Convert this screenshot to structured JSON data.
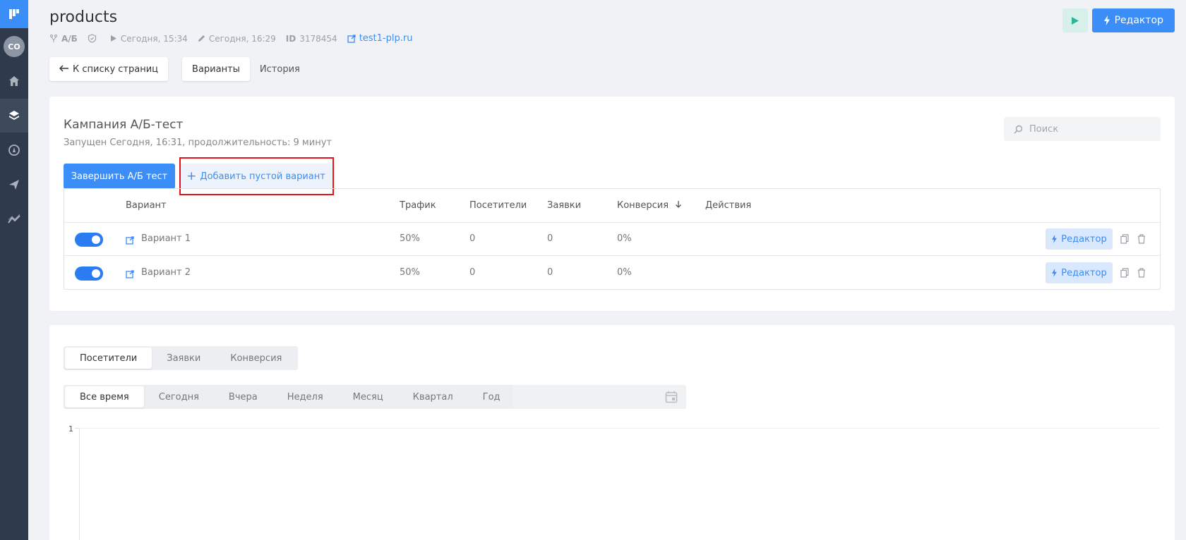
{
  "sidebar": {
    "avatar_initials": "CO",
    "items": [
      "home-icon",
      "layers-icon",
      "rocket-icon",
      "send-icon",
      "analytics-icon"
    ],
    "active_item": "layers-icon"
  },
  "header": {
    "title": "products",
    "ab_label": "А/Б",
    "started": "Сегодня, 15:34",
    "edited": "Сегодня, 16:29",
    "id_label": "ID",
    "id_value": "3178454",
    "site_link": "test1-plp.ru",
    "editor_label": "Редактор"
  },
  "nav": {
    "back_label": "К списку страниц",
    "tabs": [
      {
        "label": "Варианты",
        "active": true
      },
      {
        "label": "История",
        "active": false
      }
    ]
  },
  "campaign": {
    "title": "Кампания А/Б-тест",
    "subtitle": "Запущен Сегодня, 16:31, продолжительность: 9 минут",
    "search_placeholder": "Поиск",
    "finish_label": "Завершить А/Б тест",
    "add_label": "Добавить пустой вариант"
  },
  "table": {
    "columns": {
      "variant": "Вариант",
      "traffic": "Трафик",
      "visitors": "Посетители",
      "leads": "Заявки",
      "conversion": "Конверсия",
      "actions": "Действия"
    },
    "rows": [
      {
        "name": "Вариант 1",
        "enabled": true,
        "traffic": "50%",
        "visitors": "0",
        "leads": "0",
        "conversion": "0%",
        "editor_label": "Редактор"
      },
      {
        "name": "Вариант 2",
        "enabled": true,
        "traffic": "50%",
        "visitors": "0",
        "leads": "0",
        "conversion": "0%",
        "editor_label": "Редактор"
      }
    ]
  },
  "stats": {
    "metric_tabs": [
      {
        "label": "Посетители",
        "active": true
      },
      {
        "label": "Заявки",
        "active": false
      },
      {
        "label": "Конверсия",
        "active": false
      }
    ],
    "period_tabs": [
      {
        "label": "Все время",
        "active": true
      },
      {
        "label": "Сегодня",
        "active": false
      },
      {
        "label": "Вчера",
        "active": false
      },
      {
        "label": "Неделя",
        "active": false
      },
      {
        "label": "Месяц",
        "active": false
      },
      {
        "label": "Квартал",
        "active": false
      },
      {
        "label": "Год",
        "active": false
      }
    ],
    "date_value": "",
    "y_tick": "1"
  },
  "colors": {
    "accent": "#3b8df7",
    "sidebar": "#2f3b4c",
    "highlight": "#e3131b",
    "play": "#27b89a"
  }
}
